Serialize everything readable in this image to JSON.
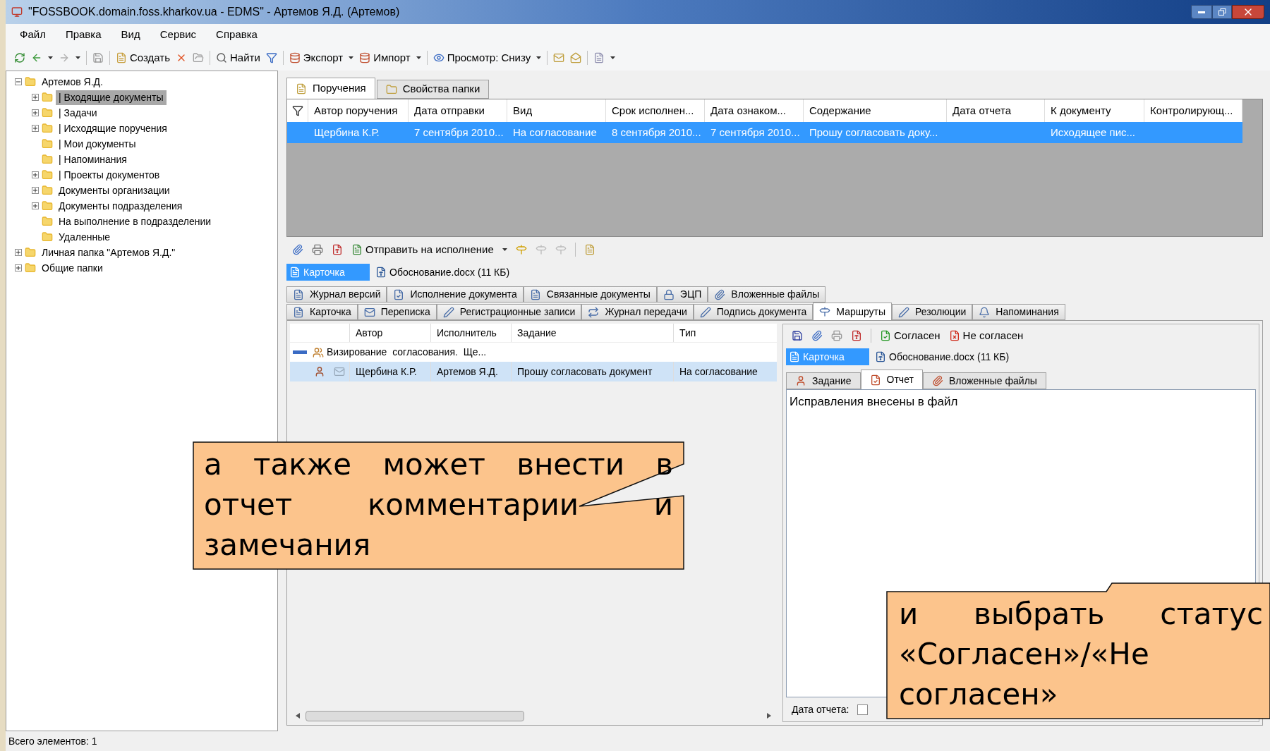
{
  "window": {
    "title": "\"FOSSBOOK.domain.foss.kharkov.ua - EDMS\" - Артемов Я.Д. (Артемов)"
  },
  "menu": [
    "Файл",
    "Правка",
    "Вид",
    "Сервис",
    "Справка"
  ],
  "toolbar": {
    "create": "Создать",
    "find": "Найти",
    "export": "Экспорт",
    "import": "Импорт",
    "view": "Просмотр: Снизу"
  },
  "tree": [
    {
      "label": "Артемов Я.Д.",
      "expanded": true,
      "selected": false,
      "children": [
        {
          "label": "| Входящие документы",
          "expanded": false,
          "selected": true
        },
        {
          "label": "| Задачи",
          "expanded": false,
          "selected": false
        },
        {
          "label": "| Исходящие поручения",
          "expanded": false,
          "selected": false
        },
        {
          "label": "| Мои документы",
          "selected": false
        },
        {
          "label": "| Напоминания",
          "selected": false
        },
        {
          "label": "| Проекты документов",
          "expanded": false,
          "selected": false
        },
        {
          "label": "Документы организации",
          "expanded": false,
          "selected": false
        },
        {
          "label": "Документы подразделения",
          "expanded": false,
          "selected": false
        },
        {
          "label": "На выполнение в подразделении",
          "selected": false
        },
        {
          "label": "Удаленные",
          "selected": false
        }
      ]
    },
    {
      "label": "Личная папка \"Артемов Я.Д.\"",
      "expanded": false,
      "selected": false
    },
    {
      "label": "Общие папки",
      "expanded": false,
      "selected": false
    }
  ],
  "top_tabs": [
    {
      "label": "Поручения",
      "selected": true
    },
    {
      "label": "Свойства папки",
      "selected": false
    }
  ],
  "orders_table": {
    "columns": [
      "Автор поручения",
      "Дата отправки",
      "Вид",
      "Срок исполнен...",
      "Дата ознаком...",
      "Содержание",
      "Дата отчета",
      "К документу",
      "Контролирующ..."
    ],
    "rows": [
      {
        "selected": true,
        "cells": [
          "Щербина К.Р.",
          "7 сентября 2010...",
          "На согласование",
          "8 сентября 2010...",
          "7 сентября 2010...",
          "Прошу согласовать доку...",
          "",
          "Исходящее пис...",
          ""
        ]
      }
    ]
  },
  "action_toolbar": {
    "send": "Отправить на исполнение"
  },
  "attachments": [
    {
      "label": "Карточка",
      "selected": true
    },
    {
      "label": "Обоснование.docx (11 КБ)",
      "selected": false
    }
  ],
  "doc_tabs_row1": [
    {
      "label": "Журнал версий",
      "selected": false
    },
    {
      "label": "Исполнение документа",
      "selected": false
    },
    {
      "label": "Связанные документы",
      "selected": false
    },
    {
      "label": "ЭЦП",
      "selected": false
    },
    {
      "label": "Вложенные файлы",
      "selected": false
    }
  ],
  "doc_tabs_row2": [
    {
      "label": "Карточка",
      "selected": false
    },
    {
      "label": "Переписка",
      "selected": false
    },
    {
      "label": "Регистрационные записи",
      "selected": false
    },
    {
      "label": "Журнал передачи",
      "selected": false
    },
    {
      "label": "Подпись документа",
      "selected": false
    },
    {
      "label": "Маршруты",
      "selected": true
    },
    {
      "label": "Резолюции",
      "selected": false
    },
    {
      "label": "Напоминания",
      "selected": false
    }
  ],
  "route_grid": {
    "columns": [
      "Автор",
      "Исполнитель",
      "Задание",
      "Тип"
    ],
    "group": {
      "label": "Визирование  согласования.  Ще...",
      "expanded": true
    },
    "rows": [
      {
        "selected": true,
        "cells": [
          "Щербина К.Р.",
          "Артемов Я.Д.",
          "Прошу согласовать документ",
          "На согласование"
        ]
      }
    ]
  },
  "route_panel": {
    "agree": "Согласен",
    "disagree": "Не согласен",
    "attachments": [
      {
        "label": "Карточка",
        "selected": true
      },
      {
        "label": "Обоснование.docx (11 КБ)",
        "selected": false
      }
    ],
    "tabs": [
      {
        "label": "Задание",
        "selected": false
      },
      {
        "label": "Отчет",
        "selected": true
      },
      {
        "label": "Вложенные файлы",
        "selected": false
      }
    ],
    "report_text": "Исправления внесены в файл",
    "date_label": "Дата отчета:",
    "date_checked": false
  },
  "status_bar": "Всего элементов: 1",
  "callouts": [
    "а также может внести в отчет комментарии и замечания",
    "и выбрать статус «Согласен»/«Не согласен»"
  ]
}
